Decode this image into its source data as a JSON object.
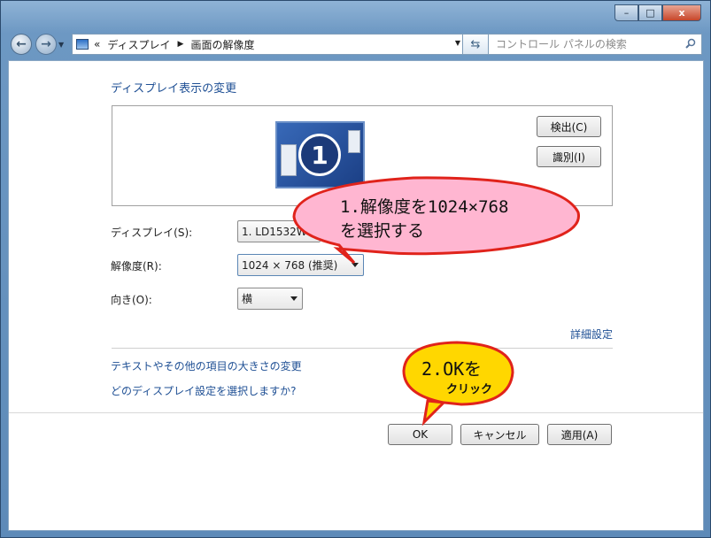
{
  "window": {
    "minimize": "–",
    "maximize": "□",
    "close": "x"
  },
  "nav": {
    "back": "←",
    "forward": "→",
    "breadcrumb_prefix": "«",
    "breadcrumb": [
      "ディスプレイ",
      "画面の解像度"
    ],
    "search_placeholder": "コントロール パネルの検索"
  },
  "main": {
    "heading": "ディスプレイ表示の変更",
    "monitor_number": "1",
    "detect_label": "検出(C)",
    "identify_label": "識別(I)",
    "display_label": "ディスプレイ(S):",
    "display_value": "1. LD1532W",
    "resolution_label": "解像度(R):",
    "resolution_value": "1024 × 768 (推奨)",
    "orientation_label": "向き(O):",
    "orientation_value": "横",
    "advanced_link": "詳細設定",
    "text_size_link": "テキストやその他の項目の大きさの変更",
    "which_setting_link": "どのディスプレイ設定を選択しますか?"
  },
  "buttons": {
    "ok": "OK",
    "cancel": "キャンセル",
    "apply": "適用(A)"
  },
  "annotations": {
    "callout1_line1": "1.解像度を1024×768",
    "callout1_line2": "を選択する",
    "callout2_line1": "2.OKを",
    "callout2_line2": "クリック"
  },
  "colors": {
    "link": "#1e4f94",
    "callout1_fill": "#ffb6d1",
    "callout1_stroke": "#e0231b",
    "callout2_fill": "#ffd700",
    "callout2_stroke": "#e0231b"
  }
}
